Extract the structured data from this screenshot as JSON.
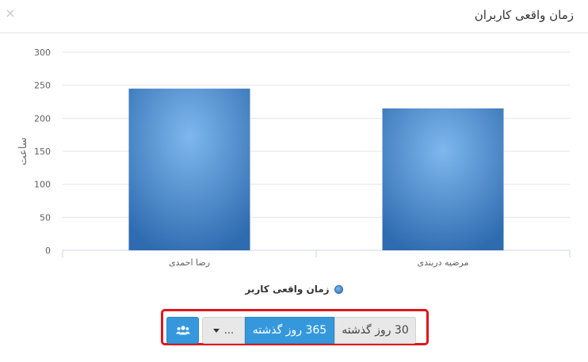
{
  "modal": {
    "title": "زمان واقعی کاربران",
    "close_glyph": "×"
  },
  "chart_data": {
    "type": "bar",
    "categories": [
      "رضا احمدی",
      "مرضیه دربندی"
    ],
    "series": [
      {
        "name": "زمان واقعی کاربر",
        "values": [
          245,
          215
        ],
        "color": "#2f6bb0"
      }
    ],
    "ylabel": "ساعت",
    "xlabel": "",
    "ylim": [
      0,
      300
    ],
    "yticks": [
      0,
      50,
      100,
      150,
      200,
      250,
      300
    ],
    "grid": true,
    "legend_position": "bottom"
  },
  "toolbar": {
    "users_icon": "users-icon",
    "more_label": "...",
    "range_365_label": "365 روز گذشته",
    "range_30_label": "30 روز گذشته",
    "active_range": "365 روز گذشته",
    "highlight_color": "#e0161c"
  }
}
